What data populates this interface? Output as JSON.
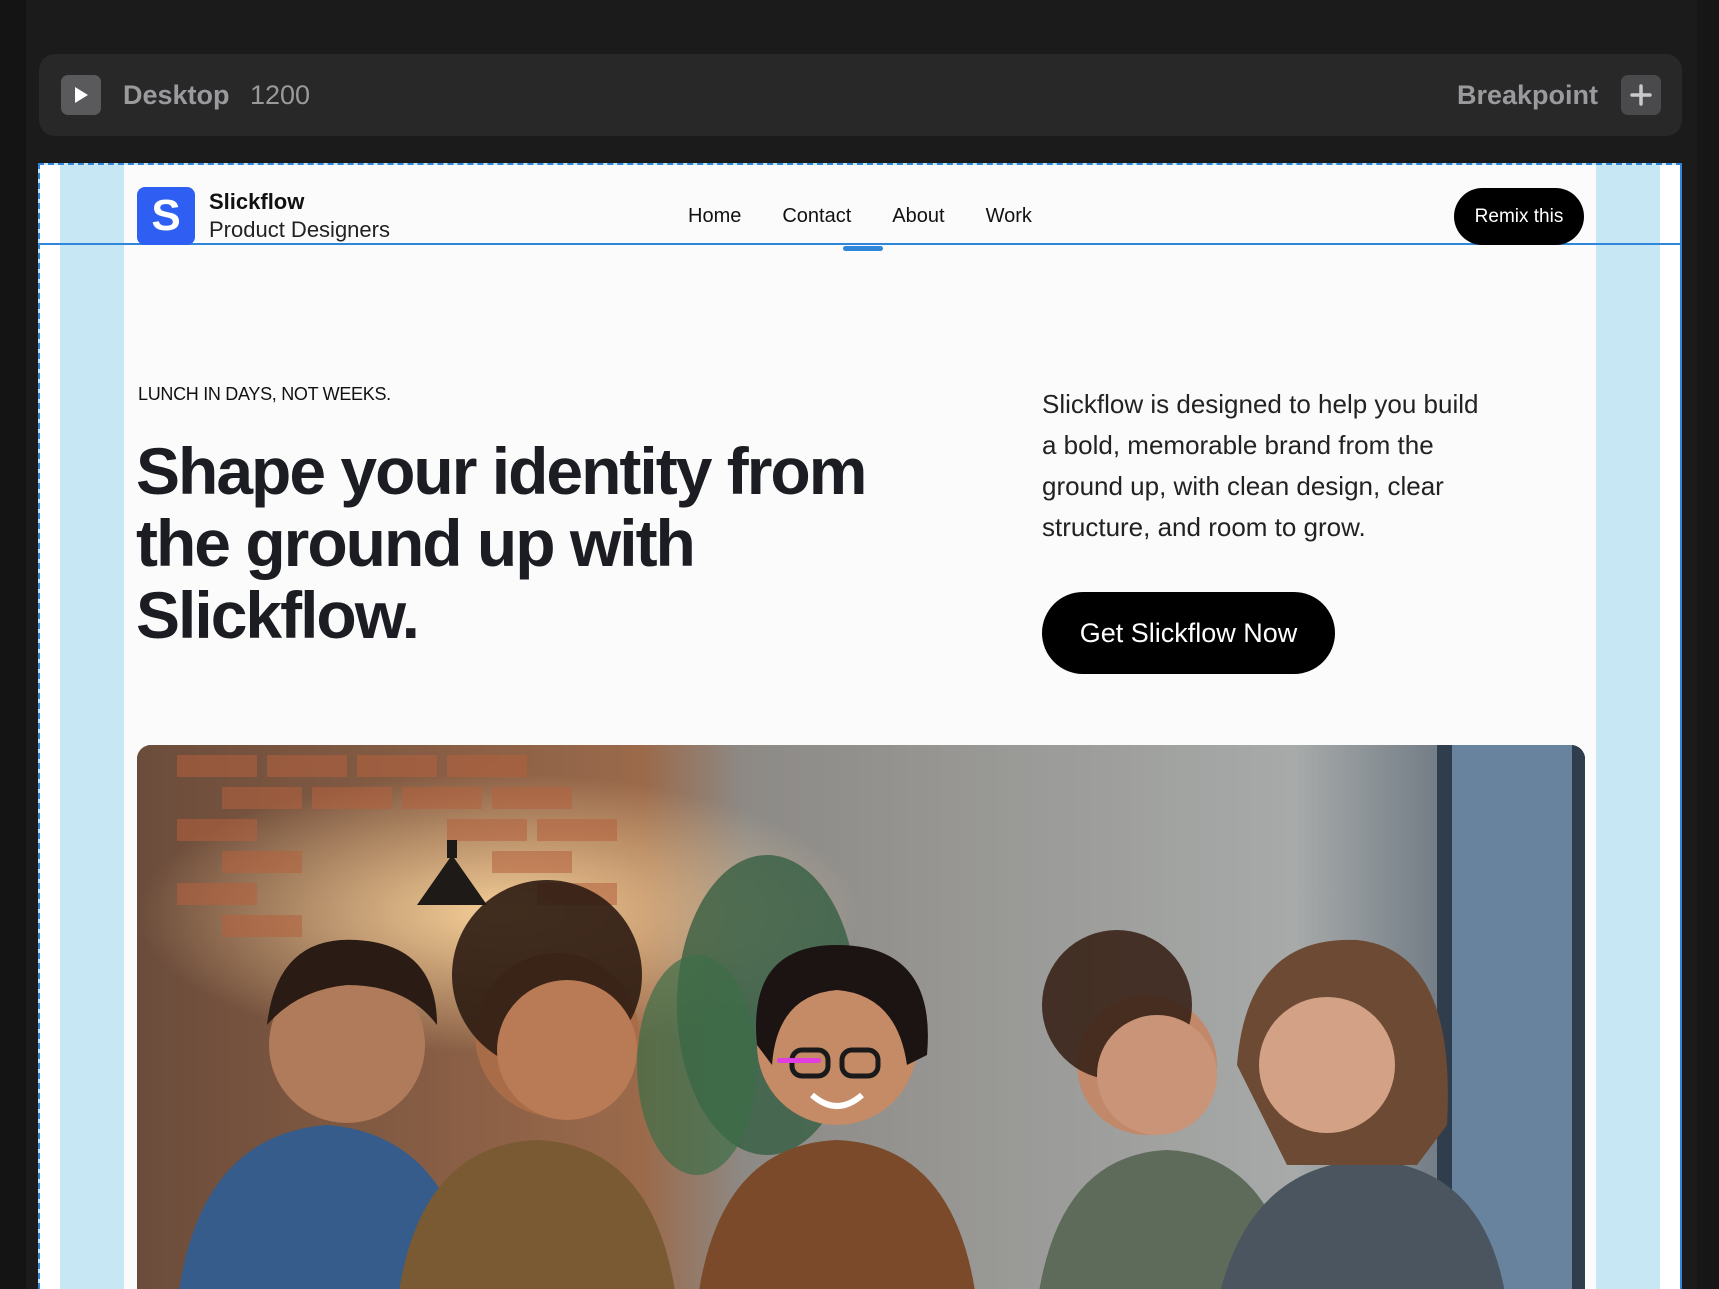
{
  "toolbar": {
    "device_label": "Desktop",
    "width_value": "1200",
    "breakpoint_label": "Breakpoint",
    "play_icon": "play-icon",
    "add_icon": "plus-icon"
  },
  "site": {
    "logo_letter": "S",
    "brand_name": "Slickflow",
    "brand_tagline": "Product Designers",
    "nav": [
      {
        "label": "Home"
      },
      {
        "label": "Contact"
      },
      {
        "label": "About"
      },
      {
        "label": "Work"
      }
    ],
    "remix_label": "Remix this"
  },
  "hero": {
    "eyebrow": "LUNCH IN DAYS, NOT WEEKS.",
    "headline": "Shape your identity from the ground up with Slickflow.",
    "description": "Slickflow is designed to help you build a bold, memorable brand from the ground up, with clean design, clear structure, and room to grow.",
    "cta_label": "Get Slickflow Now"
  },
  "colors": {
    "accent": "#2f86db",
    "logo_bg": "#2f5ef2",
    "button_bg": "#000000",
    "canvas_bg": "#c7e7f4"
  }
}
